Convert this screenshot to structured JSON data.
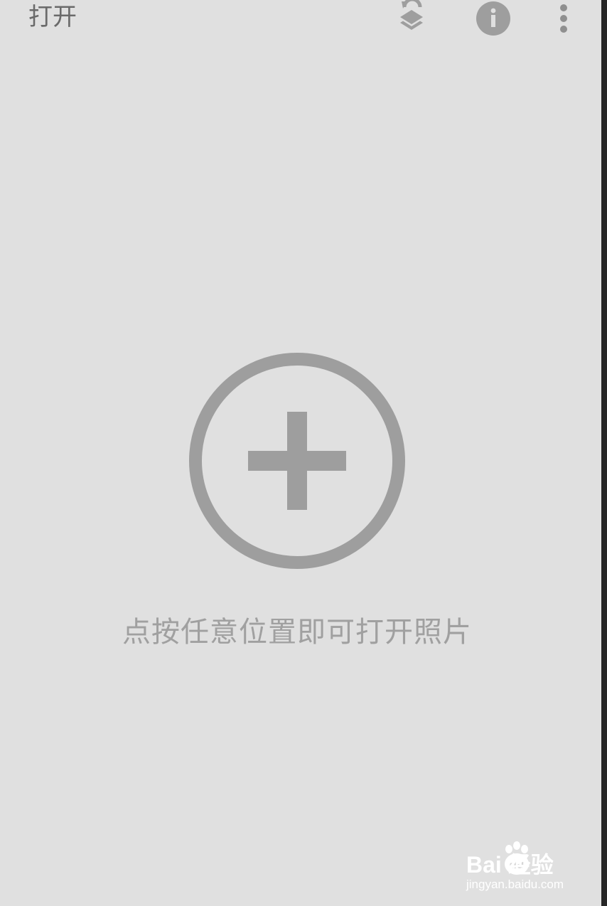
{
  "toolbar": {
    "title": "打开",
    "icons": {
      "undo_layers": "undo-layers-icon",
      "info": "info-icon",
      "more": "more-vert-icon"
    }
  },
  "main": {
    "add_icon": "add-circle-icon",
    "hint": "点按任意位置即可打开照片"
  },
  "watermark": {
    "brand": "Bai  经验",
    "brand_du": "du",
    "url": "jingyan.baidu.com"
  },
  "colors": {
    "background": "#e0e0e0",
    "icon": "#9e9e9e",
    "title_text": "#6a6a6a",
    "hint_text": "#a0a0a0"
  }
}
